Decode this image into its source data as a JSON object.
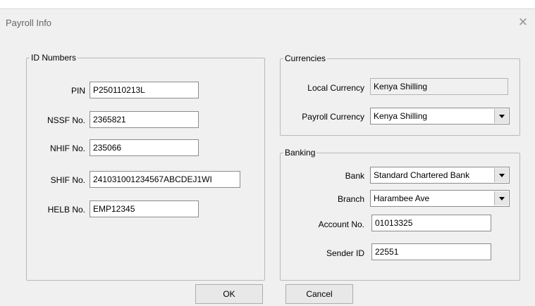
{
  "window": {
    "title": "Payroll Info",
    "close_glyph": "✕"
  },
  "id_numbers": {
    "legend": "ID Numbers",
    "fields": [
      {
        "label": "PIN",
        "value": "P250110213L"
      },
      {
        "label": "NSSF No.",
        "value": "2365821"
      },
      {
        "label": "NHIF No.",
        "value": "235066"
      },
      {
        "label": "SHIF No.",
        "value": "241031001234567ABCDEJ1WI"
      },
      {
        "label": "HELB No.",
        "value": "EMP12345"
      }
    ]
  },
  "currencies": {
    "legend": "Currencies",
    "local_label": "Local Currency",
    "local_value": "Kenya Shilling",
    "payroll_label": "Payroll Currency",
    "payroll_value": "Kenya Shilling"
  },
  "banking": {
    "legend": "Banking",
    "bank_label": "Bank",
    "bank_value": "Standard Chartered Bank",
    "branch_label": "Branch",
    "branch_value": "Harambee Ave",
    "account_label": "Account No.",
    "account_value": "01013325",
    "sender_label": "Sender ID",
    "sender_value": "22551"
  },
  "buttons": {
    "ok": "OK",
    "cancel": "Cancel"
  }
}
